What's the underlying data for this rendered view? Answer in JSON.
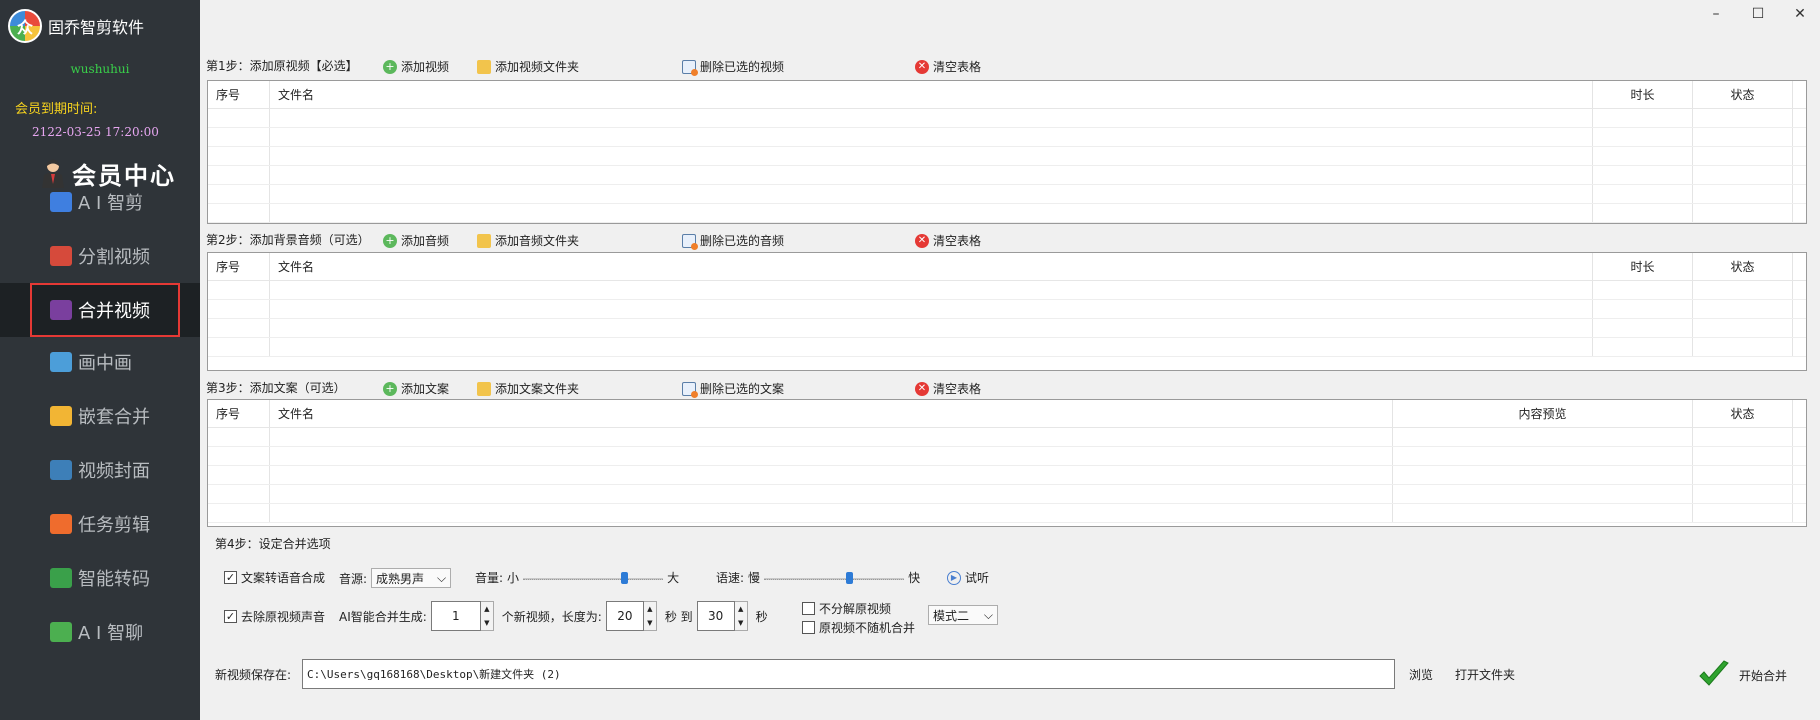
{
  "brand": {
    "name": "固乔智剪软件",
    "logo_char": "众"
  },
  "user": {
    "name": "wushuhui",
    "expire_label": "会员到期时间:",
    "expire_time": "2122-03-25 17:20:00"
  },
  "vip": {
    "label": "会员中心"
  },
  "nav": [
    {
      "label": "A I 智剪",
      "icon": "ai-cut-icon",
      "color": "#3f7fe0"
    },
    {
      "label": "分割视频",
      "icon": "split-video-icon",
      "color": "#d64a3b"
    },
    {
      "label": "合并视频",
      "icon": "merge-video-icon",
      "color": "#7a3f9e",
      "active": true
    },
    {
      "label": "画中画",
      "icon": "picture-in-picture-icon",
      "color": "#4c9ed9"
    },
    {
      "label": "嵌套合并",
      "icon": "nested-merge-icon",
      "color": "#f2b534"
    },
    {
      "label": "视频封面",
      "icon": "video-cover-icon",
      "color": "#3d7fb8"
    },
    {
      "label": "任务剪辑",
      "icon": "task-edit-icon",
      "color": "#ef6c2d"
    },
    {
      "label": "智能转码",
      "icon": "smart-transcode-icon",
      "color": "#3aa04a"
    },
    {
      "label": "A I 智聊",
      "icon": "ai-chat-icon",
      "color": "#4caf50"
    }
  ],
  "window": {
    "minimize": "–",
    "maximize": "☐",
    "close": "✕"
  },
  "step1": {
    "label": "第1步：添加原视频【必选】",
    "add": "添加视频",
    "add_folder": "添加视频文件夹",
    "delete": "删除已选的视频",
    "clear": "清空表格",
    "columns": [
      "序号",
      "文件名",
      "时长",
      "状态"
    ]
  },
  "step2": {
    "label": "第2步：添加背景音频（可选）",
    "add": "添加音频",
    "add_folder": "添加音频文件夹",
    "delete": "删除已选的音频",
    "clear": "清空表格",
    "columns": [
      "序号",
      "文件名",
      "时长",
      "状态"
    ]
  },
  "step3": {
    "label": "第3步：添加文案（可选）",
    "add": "添加文案",
    "add_folder": "添加文案文件夹",
    "delete": "删除已选的文案",
    "clear": "清空表格",
    "columns": [
      "序号",
      "文件名",
      "内容预览",
      "状态"
    ]
  },
  "step4": {
    "label": "第4步：设定合并选项",
    "tts_checkbox": "文案转语音合成",
    "tts_checked": true,
    "voice_label": "音源:",
    "voice_value": "成熟男声",
    "volume_label": "音量:",
    "volume_min": "小",
    "volume_max": "大",
    "volume_level": 0.74,
    "speed_label": "语速:",
    "speed_min": "慢",
    "speed_max": "快",
    "speed_level": 0.62,
    "preview": "试听",
    "remove_audio": "去除原视频声音",
    "remove_audio_checked": true,
    "ai_generate_label": "AI智能合并生成:",
    "count": "1",
    "count_suffix": "个新视频，长度为:",
    "len_from": "20",
    "sec_to": "秒 到",
    "len_to": "30",
    "sec": "秒",
    "no_split": "不分解原视频",
    "no_split_checked": false,
    "no_random": "原视频不随机合并",
    "no_random_checked": false,
    "mode_value": "模式二"
  },
  "save": {
    "label": "新视频保存在:",
    "path": "C:\\Users\\gq168168\\Desktop\\新建文件夹 (2)",
    "browse": "浏览",
    "open_folder": "打开文件夹",
    "start": "开始合并"
  }
}
